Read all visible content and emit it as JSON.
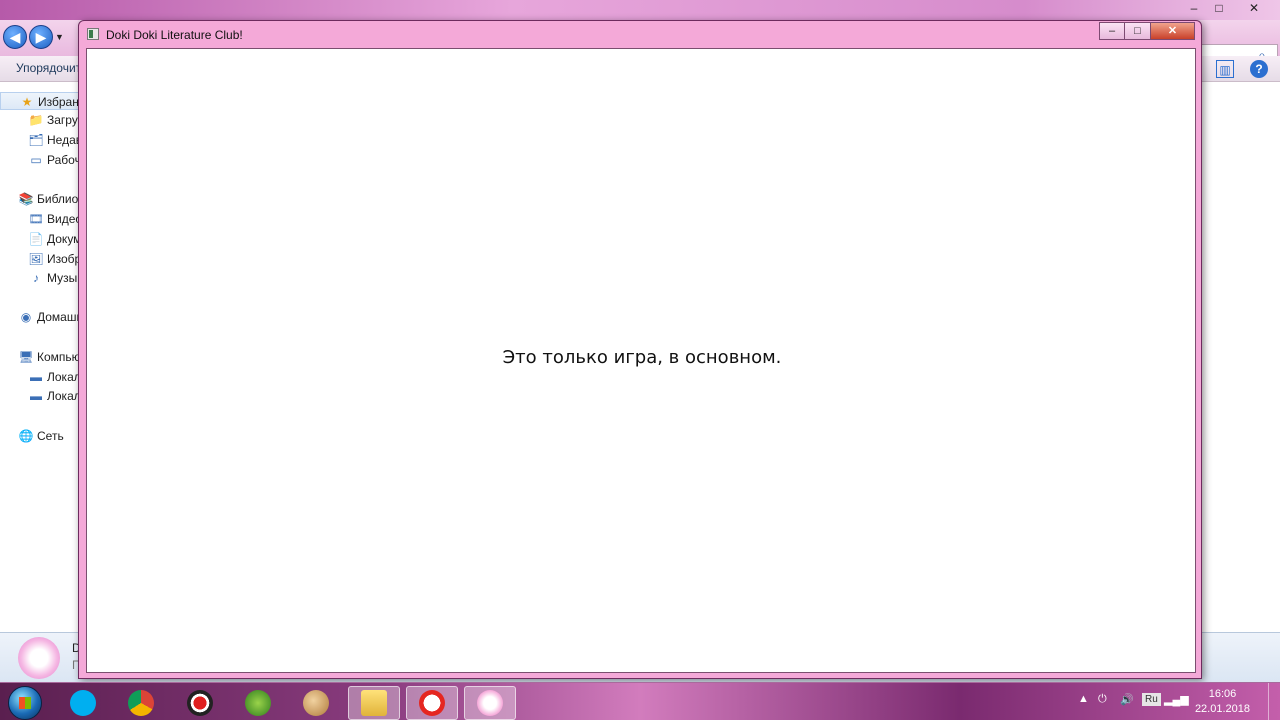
{
  "explorer": {
    "organize_label": "Упорядочить",
    "sidebar": [
      {
        "label": "Избранное",
        "icon": "star-icon",
        "indent": 0
      },
      {
        "label": "Загрузки",
        "icon": "downloads-folder-icon",
        "indent": 1
      },
      {
        "label": "Недавние места",
        "icon": "recent-places-icon",
        "indent": 1
      },
      {
        "label": "Рабочий стол",
        "icon": "desktop-icon",
        "indent": 1
      },
      {
        "label": "Библиотеки",
        "icon": "libraries-icon",
        "indent": 0
      },
      {
        "label": "Видео",
        "icon": "video-library-icon",
        "indent": 1
      },
      {
        "label": "Документы",
        "icon": "documents-library-icon",
        "indent": 1
      },
      {
        "label": "Изображения",
        "icon": "pictures-library-icon",
        "indent": 1
      },
      {
        "label": "Музыка",
        "icon": "music-library-icon",
        "indent": 1
      },
      {
        "label": "Домашняя группа",
        "icon": "homegroup-icon",
        "indent": 0
      },
      {
        "label": "Компьютер",
        "icon": "computer-icon",
        "indent": 0
      },
      {
        "label": "Локальный диск",
        "icon": "local-disk-icon",
        "indent": 1
      },
      {
        "label": "Локальный диск",
        "icon": "local-disk-icon",
        "indent": 1
      },
      {
        "label": "Сеть",
        "icon": "network-icon",
        "indent": 0
      }
    ],
    "details_line1": "D",
    "details_line2": "П"
  },
  "game_window": {
    "title": "Doki Doki Literature Club!",
    "minimize": "–",
    "maximize": "□",
    "close": "✕",
    "dialogue_text": "Это только игра, в основном."
  },
  "taskbar": {
    "apps": [
      {
        "name": "skype",
        "icon": "skype-icon",
        "active": false
      },
      {
        "name": "chrome",
        "icon": "chrome-icon",
        "active": false
      },
      {
        "name": "recorder",
        "icon": "recorder-icon",
        "active": false
      },
      {
        "name": "green-app",
        "icon": "green-app-icon",
        "active": false
      },
      {
        "name": "paint",
        "icon": "paint-palette-icon",
        "active": false
      },
      {
        "name": "explorer",
        "icon": "folder-icon",
        "active": true
      },
      {
        "name": "yandex-browser",
        "icon": "yandex-icon",
        "active": true
      },
      {
        "name": "ddlc",
        "icon": "ddlc-icon",
        "active": true
      }
    ],
    "language": "Ru",
    "time": "16:06",
    "date": "22.01.2018"
  },
  "colors": {
    "window_frame": "#f4a9d8",
    "accent_blue": "#1c5fc2"
  }
}
